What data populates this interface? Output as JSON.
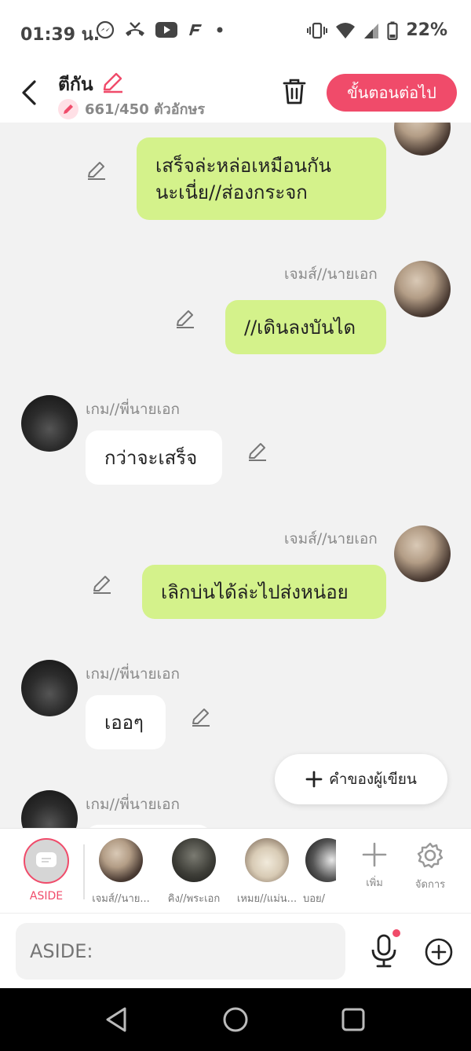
{
  "status_bar": {
    "time": "01:39 น.",
    "battery": "22%",
    "icons": [
      "messenger-icon",
      "missed-call-icon",
      "youtube-icon",
      "app-icon",
      "dot-icon",
      "vibrate-icon",
      "wifi-icon",
      "signal-icon",
      "battery-icon"
    ]
  },
  "header": {
    "title": "ตีกัน",
    "char_count": "661/450 ตัวอักษร",
    "next_label": "ขั้นตอนต่อไป",
    "accent": "#f04b6a"
  },
  "messages": [
    {
      "side": "right",
      "speaker": "",
      "text_line1": "เสร็จล่ะหล่อเหมือนกัน",
      "text_line2": "นะเนี่ย//ส่องกระจก"
    },
    {
      "side": "right",
      "speaker": "เจมส์//นายเอก",
      "text": "//เดินลงบันได"
    },
    {
      "side": "left",
      "speaker": "เกม//พี่นายเอก",
      "text": "กว่าจะเสร็จ"
    },
    {
      "side": "right",
      "speaker": "เจมส์//นายเอก",
      "text": "เลิกบ่นได้ล่ะไปส่งหน่อย"
    },
    {
      "side": "left",
      "speaker": "เกม//พี่นายเอก",
      "text": "เออๆ"
    },
    {
      "side": "left",
      "speaker": "เกม//พี่นายเอก",
      "text": ""
    }
  ],
  "writer_button": {
    "label": "คำของผู้เขียน"
  },
  "characters": {
    "aside_label": "ASIDE",
    "items": [
      {
        "name": "เจมส์//นาย..."
      },
      {
        "name": "คิง//พระเอก"
      },
      {
        "name": "เหมย//แม่น..."
      },
      {
        "name": "บอย/"
      }
    ],
    "add_label": "เพิ่ม",
    "manage_label": "จัดการ"
  },
  "input": {
    "placeholder": "ASIDE:"
  },
  "colors": {
    "mine_bubble": "#d4f28b",
    "theirs_bubble": "#ffffff",
    "accent": "#f04b6a"
  }
}
